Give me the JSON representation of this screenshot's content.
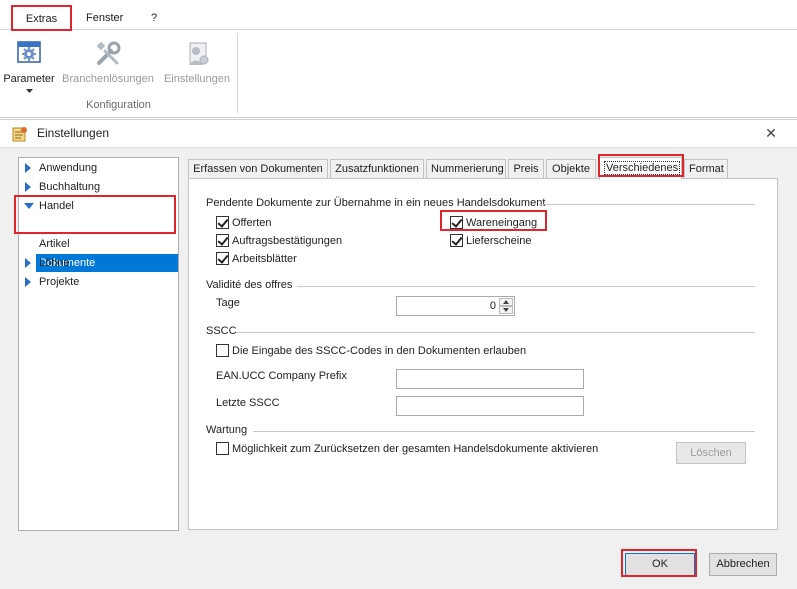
{
  "menubar": {
    "items": [
      "Extras",
      "Fenster",
      "?"
    ]
  },
  "ribbon": {
    "buttons": [
      {
        "label": "Parameter",
        "icon": "gear-window-icon",
        "enabled": true
      },
      {
        "label": "Branchenlösungen",
        "icon": "wrench-screwdriver-icon",
        "enabled": false
      },
      {
        "label": "Einstellungen",
        "icon": "user-settings-icon",
        "enabled": false
      }
    ],
    "group_label": "Konfiguration"
  },
  "dialog": {
    "title": "Einstellungen",
    "close_glyph": "✕",
    "tree": [
      {
        "label": "Anwendung",
        "expanded": false
      },
      {
        "label": "Buchhaltung",
        "expanded": false
      },
      {
        "label": "Handel",
        "expanded": true
      },
      {
        "label": "Dokumente",
        "selected": true
      },
      {
        "label": "Artikel"
      },
      {
        "label": "Löhne",
        "expanded": false
      },
      {
        "label": "Projekte",
        "expanded": false
      }
    ],
    "tabs": [
      "Erfassen von Dokumenten",
      "Zusatzfunktionen",
      "Nummerierung",
      "Preis",
      "Objekte",
      "Verschiedenes",
      "Format"
    ],
    "active_tab": "Verschiedenes",
    "pending": {
      "title": "Pendente Dokumente zur Übernahme in ein neues Handelsdokument",
      "items": [
        {
          "label": "Offerten",
          "checked": true
        },
        {
          "label": "Auftragsbestätigungen",
          "checked": true
        },
        {
          "label": "Arbeitsblätter",
          "checked": true
        },
        {
          "label": "Wareneingang",
          "checked": true
        },
        {
          "label": "Lieferscheine",
          "checked": true
        }
      ]
    },
    "validity": {
      "title": "Validité des offres",
      "tage_label": "Tage",
      "tage_value": "0"
    },
    "sscc": {
      "title": "SSCC",
      "allow_label": "Die Eingabe des SSCC-Codes in den Dokumenten erlauben",
      "allow_checked": false,
      "prefix_label": "EAN.UCC Company Prefix",
      "prefix_value": "",
      "last_label": "Letzte  SSCC",
      "last_value": ""
    },
    "wartung": {
      "title": "Wartung",
      "reset_label": "Möglichkeit zum Zurücksetzen der gesamten Handelsdokumente aktivieren",
      "reset_checked": false,
      "delete_label": "Löschen"
    },
    "ok_label": "OK",
    "cancel_label": "Abbrechen"
  },
  "colors": {
    "accent": "#0078d7",
    "highlight": "#e0252d",
    "tree_arrow": "#2b6fc7"
  }
}
